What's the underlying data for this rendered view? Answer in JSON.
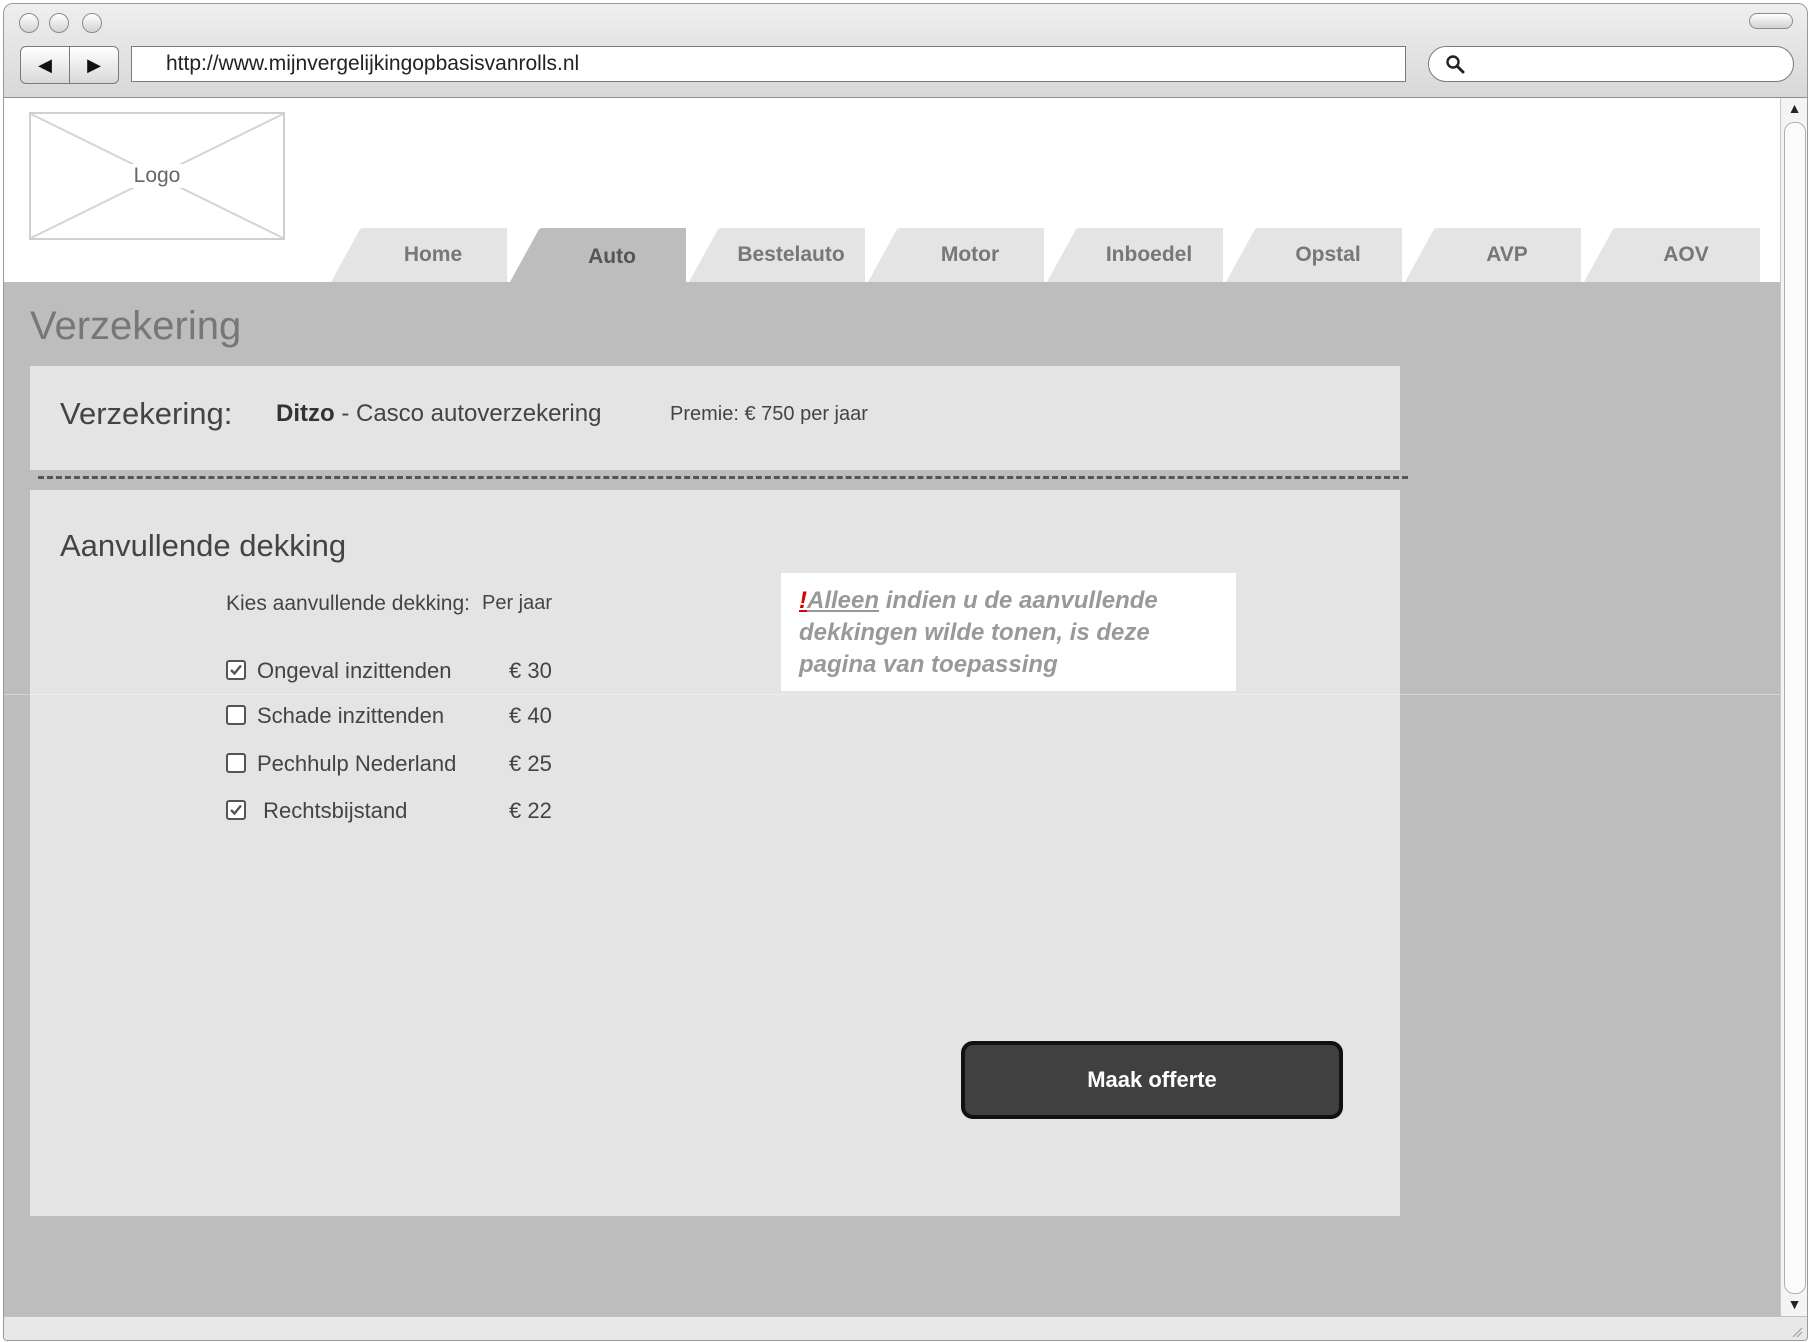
{
  "browser": {
    "url": "http://www.mijnvergelijkingopbasisvanrolls.nl",
    "back_icon": "◀",
    "forward_icon": "▶",
    "search_placeholder": ""
  },
  "header": {
    "logo_label": "Logo",
    "tabs": [
      {
        "label": "Home",
        "active": false
      },
      {
        "label": "Auto",
        "active": true
      },
      {
        "label": "Bestelauto",
        "active": false
      },
      {
        "label": "Motor",
        "active": false
      },
      {
        "label": "Inboedel",
        "active": false
      },
      {
        "label": "Opstal",
        "active": false
      },
      {
        "label": "AVP",
        "active": false
      },
      {
        "label": "AOV",
        "active": false
      }
    ]
  },
  "page": {
    "title": "Verzekering"
  },
  "insurance": {
    "label": "Verzekering:",
    "brand": "Ditzo",
    "product": " - Casco autoverzekering",
    "premium": "Premie: € 750 per jaar"
  },
  "coverage": {
    "heading": "Aanvullende dekking",
    "choose_label": "Kies aanvullende dekking:",
    "per_year_label": "Per jaar",
    "options": [
      {
        "label": "Ongeval inzittenden",
        "price": "€ 30",
        "checked": true
      },
      {
        "label": "Schade inzittenden",
        "price": "€ 40",
        "checked": false
      },
      {
        "label": "Pechhulp Nederland",
        "price": "€ 25",
        "checked": false
      },
      {
        "label": " Rechtsbijstand",
        "price": "€ 22",
        "checked": true
      }
    ]
  },
  "note": {
    "bang": "!",
    "emph": "Alleen",
    "rest": " indien u de aanvullende dekkingen wilde tonen, is deze pagina van toepassing"
  },
  "actions": {
    "make_quote": "Maak offerte"
  },
  "scrollbar": {
    "up_icon": "▲",
    "down_icon": "▼"
  },
  "colors": {
    "page_background": "#bdbdbd",
    "panel": "#e4e4e4",
    "button": "#404040",
    "note_accent": "#dd0000"
  }
}
